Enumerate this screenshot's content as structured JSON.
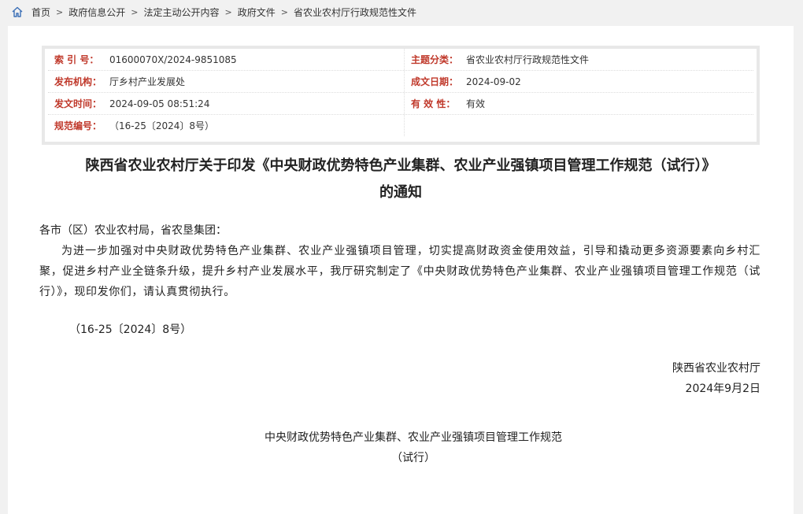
{
  "breadcrumb": {
    "items": [
      "首页",
      "政府信息公开",
      "法定主动公开内容",
      "政府文件",
      "省农业农村厅行政规范性文件"
    ],
    "separator": ">"
  },
  "meta": {
    "index_label": "索 引 号：",
    "index_value": "01600070X/2024-9851085",
    "topic_label": "主题分类：",
    "topic_value": "省农业农村厅行政规范性文件",
    "issuer_label": "发布机构：",
    "issuer_value": "厅乡村产业发展处",
    "written_label": "成文日期：",
    "written_value": "2024-09-02",
    "published_label": "发文时间：",
    "published_value": "2024-09-05 08:51:24",
    "validity_label": "有 效 性：",
    "validity_value": "有效",
    "docno_label": "规范编号：",
    "docno_value": "（16-25〔2024〕8号）"
  },
  "document": {
    "title_line1": "陕西省农业农村厅关于印发《中央财政优势特色产业集群、农业产业强镇项目管理工作规范（试行）》",
    "title_line2": "的通知",
    "salutation": "各市（区）农业农村局，省农垦集团：",
    "paragraph": "为进一步加强对中央财政优势特色产业集群、农业产业强镇项目管理，切实提高财政资金使用效益，引导和撬动更多资源要素向乡村汇聚，促进乡村产业全链条升级，提升乡村产业发展水平，我厅研究制定了《中央财政优势特色产业集群、农业产业强镇项目管理工作规范（试行）》，现印发你们，请认真贯彻执行。",
    "doc_number": "（16-25〔2024〕8号）",
    "signer": "陕西省农业农村厅",
    "sign_date": "2024年9月2日",
    "sub_title_line1": "中央财政优势特色产业集群、农业产业强镇项目管理工作规范",
    "sub_title_line2": "（试行）"
  },
  "colors": {
    "label_red": "#c0392b",
    "page_bg": "#f1f1f1",
    "home_icon": "#3b6fb6"
  },
  "icons": [
    "home-icon"
  ]
}
